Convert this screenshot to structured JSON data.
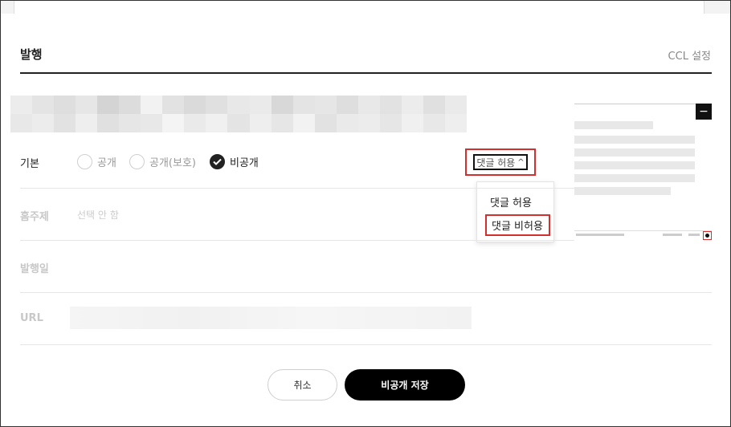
{
  "header": {
    "title": "발행",
    "ccl_label": "CCL 설정"
  },
  "rows": {
    "basic": {
      "label": "기본",
      "options": [
        "공개",
        "공개(보호)",
        "비공개"
      ],
      "selected": "비공개",
      "comment_select": "댓글 허용",
      "comment_options": [
        "댓글 허용",
        "댓글 비허용"
      ]
    },
    "topic": {
      "label": "홈주제",
      "placeholder": "선택 안 함"
    },
    "date": {
      "label": "발행일"
    },
    "url": {
      "label": "URL"
    }
  },
  "footer": {
    "cancel_label": "취소",
    "save_label": "비공개 저장"
  },
  "preview": {
    "collapse_icon": "minus-icon"
  },
  "colors": {
    "accent": "#000000",
    "highlight": "#d32f2f"
  }
}
